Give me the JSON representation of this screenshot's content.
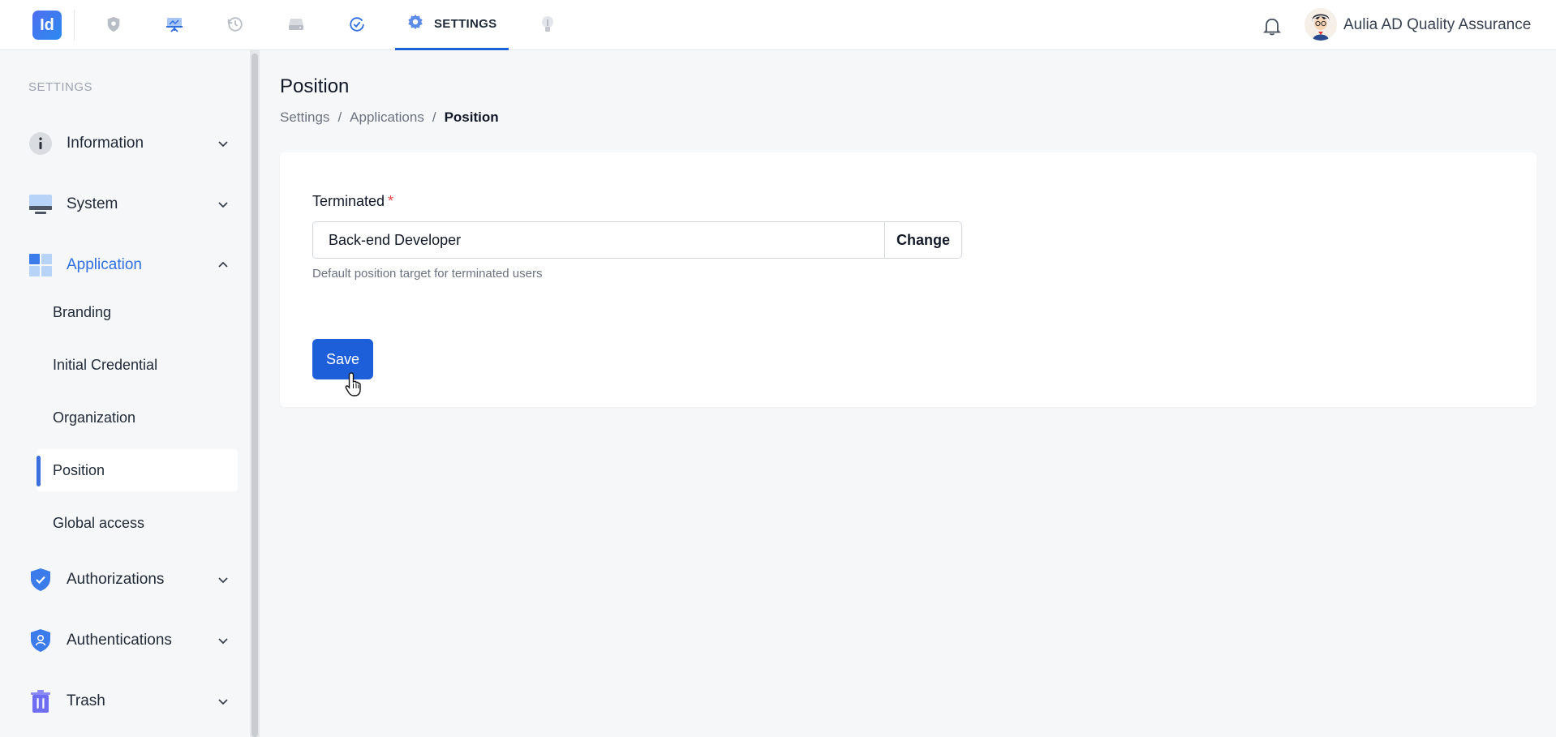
{
  "app": {
    "logo_text": "Id"
  },
  "topnav": {
    "icons": [
      "shield-icon",
      "presentation-icon",
      "history-icon",
      "drive-icon",
      "check-circle-icon"
    ],
    "active_tab": {
      "icon": "gear-icon",
      "label": "SETTINGS"
    },
    "extra_icon": "lightbulb-icon",
    "accent": "#1d63d8"
  },
  "user": {
    "name": "Aulia AD Quality Assurance"
  },
  "sidebar": {
    "heading": "SETTINGS",
    "groups": [
      {
        "label": "Information",
        "icon": "info-icon",
        "expanded": false
      },
      {
        "label": "System",
        "icon": "monitor-icon",
        "expanded": false
      },
      {
        "label": "Application",
        "icon": "grid-icon",
        "expanded": true,
        "items": [
          "Branding",
          "Initial Credential",
          "Organization",
          "Position",
          "Global access"
        ],
        "active_item": "Position"
      },
      {
        "label": "Authorizations",
        "icon": "shield-check-icon",
        "expanded": false
      },
      {
        "label": "Authentications",
        "icon": "shield-user-icon",
        "expanded": false
      },
      {
        "label": "Trash",
        "icon": "trash-icon",
        "expanded": false
      }
    ]
  },
  "page": {
    "title": "Position",
    "breadcrumb": [
      "Settings",
      "Applications",
      "Position"
    ],
    "separator": "/"
  },
  "form": {
    "label": "Terminated",
    "required_mark": "*",
    "value": "Back-end Developer",
    "change_label": "Change",
    "help": "Default position target for terminated users",
    "save_label": "Save"
  },
  "colors": {
    "primary": "#1d5fd8",
    "active_text": "#2f6fe0",
    "required": "#ef4444"
  }
}
